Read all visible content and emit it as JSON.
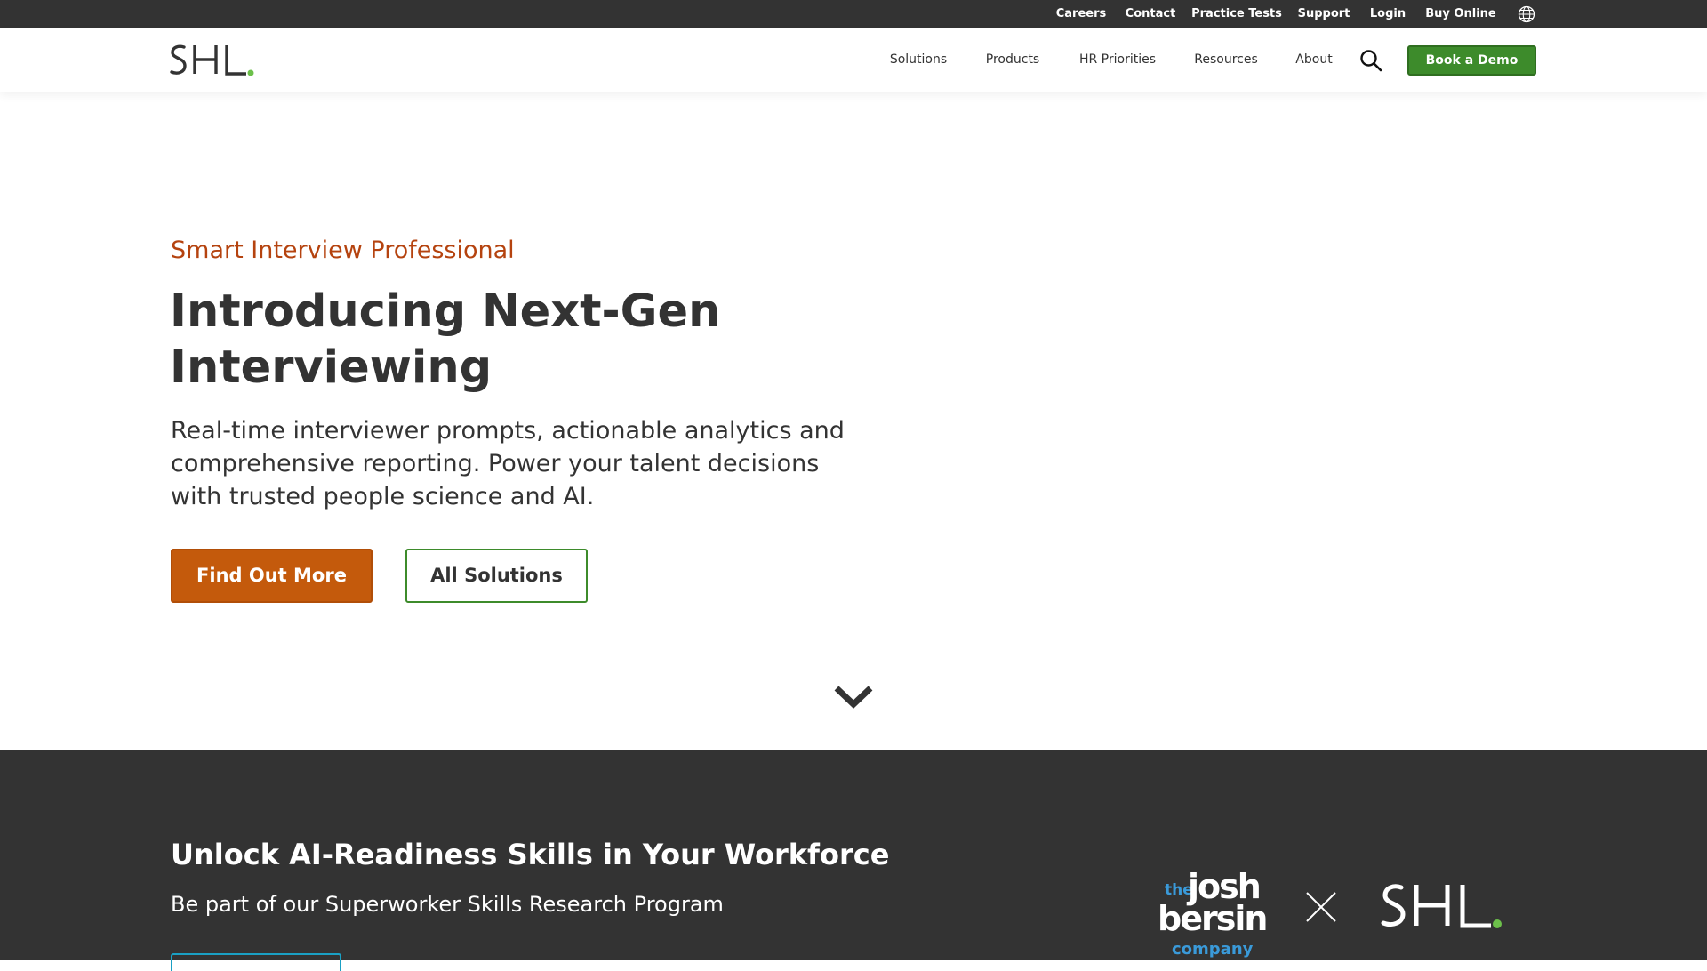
{
  "utility_nav": {
    "items": [
      "Careers",
      "Contact",
      "Practice Tests",
      "Support",
      "Login",
      "Buy Online"
    ],
    "language_icon": "globe-icon"
  },
  "header": {
    "logo_text": "SHL.",
    "nav_items": [
      "Solutions",
      "Products",
      "HR Priorities",
      "Resources",
      "About"
    ],
    "search_icon": "search-icon",
    "cta_label": "Book a Demo"
  },
  "hero": {
    "eyebrow": "Smart Interview Professional",
    "title": "Introducing Next-Gen Interviewing",
    "description": "Real-time interviewer prompts, actionable analytics and comprehensive reporting. Power your talent decisions with trusted people science and AI.",
    "primary_button": "Find Out More",
    "secondary_button": "All Solutions",
    "scroll_icon": "chevron-down-icon"
  },
  "promo": {
    "title": "Unlock AI-Readiness Skills in Your Workforce",
    "subtitle": "Be part of our Superworker Skills Research Program",
    "partner_logo": {
      "the": "the",
      "josh": "josh",
      "bersin": "bersin",
      "company": "company"
    },
    "separator_icon": "close-icon",
    "shl_logo_text": "SHL."
  },
  "colors": {
    "dark_bar": "#333333",
    "brand_green": "#3d8b2b",
    "brand_orange": "#c45a0c",
    "eyebrow_orange": "#b5430f",
    "accent_blue": "#1aa0c4",
    "logo_dot_green": "#6cc04a"
  }
}
